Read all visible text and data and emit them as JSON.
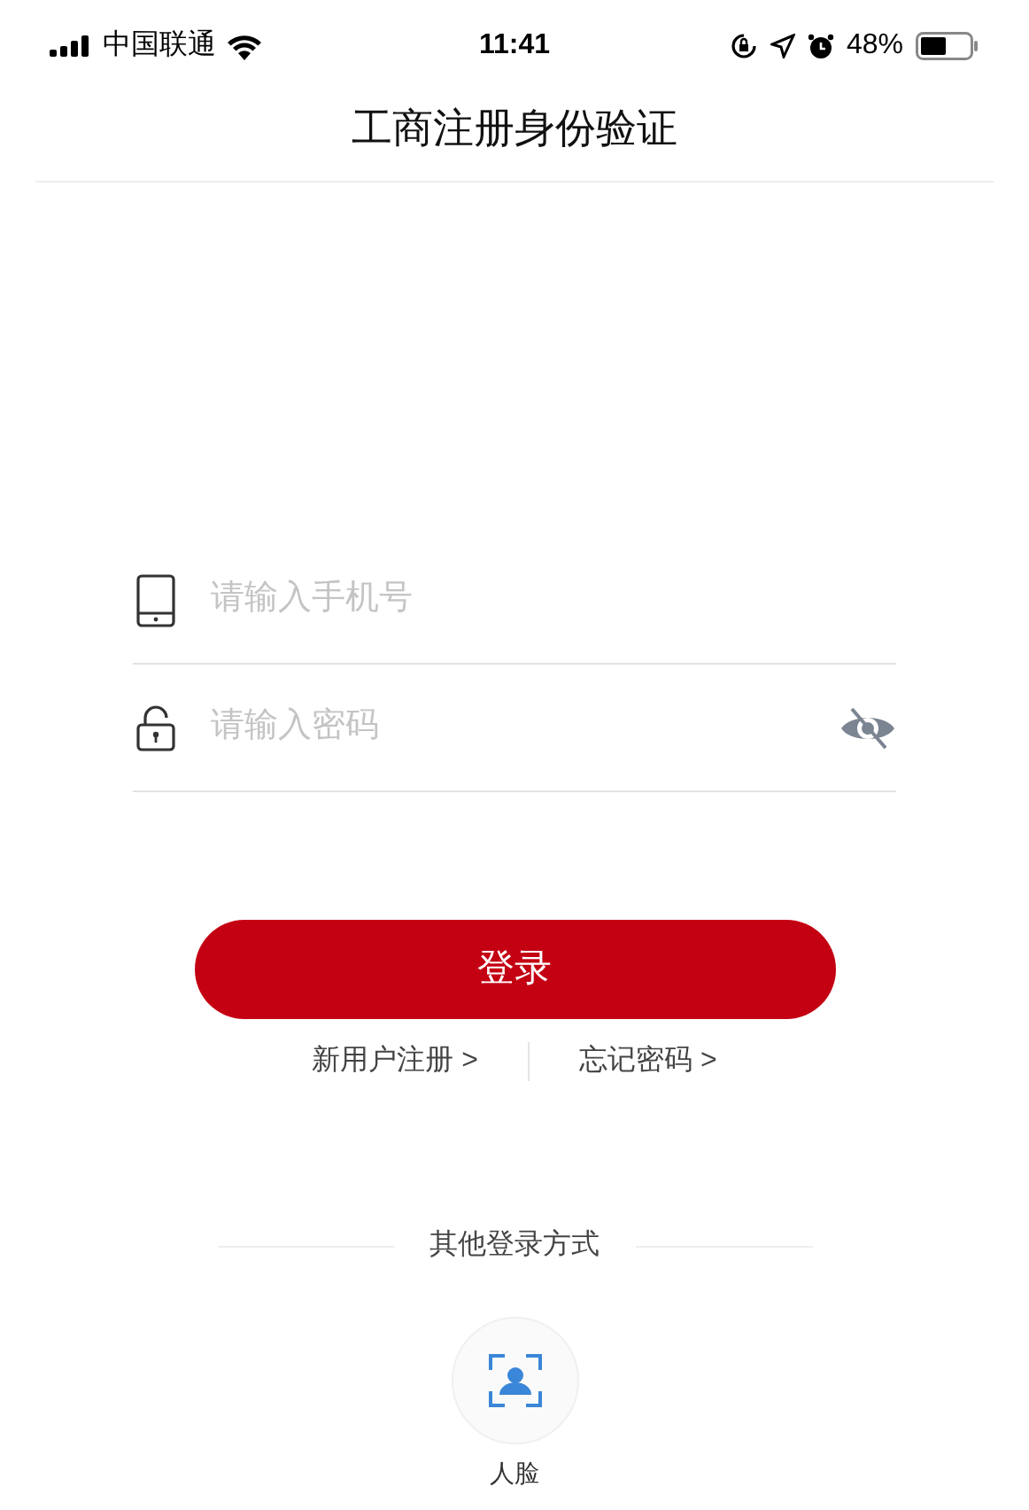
{
  "status_bar": {
    "carrier": "中国联通",
    "time": "11:41",
    "battery": "48%"
  },
  "header": {
    "title": "工商注册身份验证"
  },
  "form": {
    "fields": [
      {
        "kind": "phone",
        "placeholder": "请输入手机号"
      },
      {
        "kind": "password",
        "placeholder": "请输入密码"
      }
    ],
    "login_button": "登录",
    "links": [
      "新用户注册 >",
      "忘记密码 >"
    ]
  },
  "other_login": {
    "heading": "其他登录方式",
    "methods": [
      {
        "label": "人脸"
      }
    ]
  }
}
